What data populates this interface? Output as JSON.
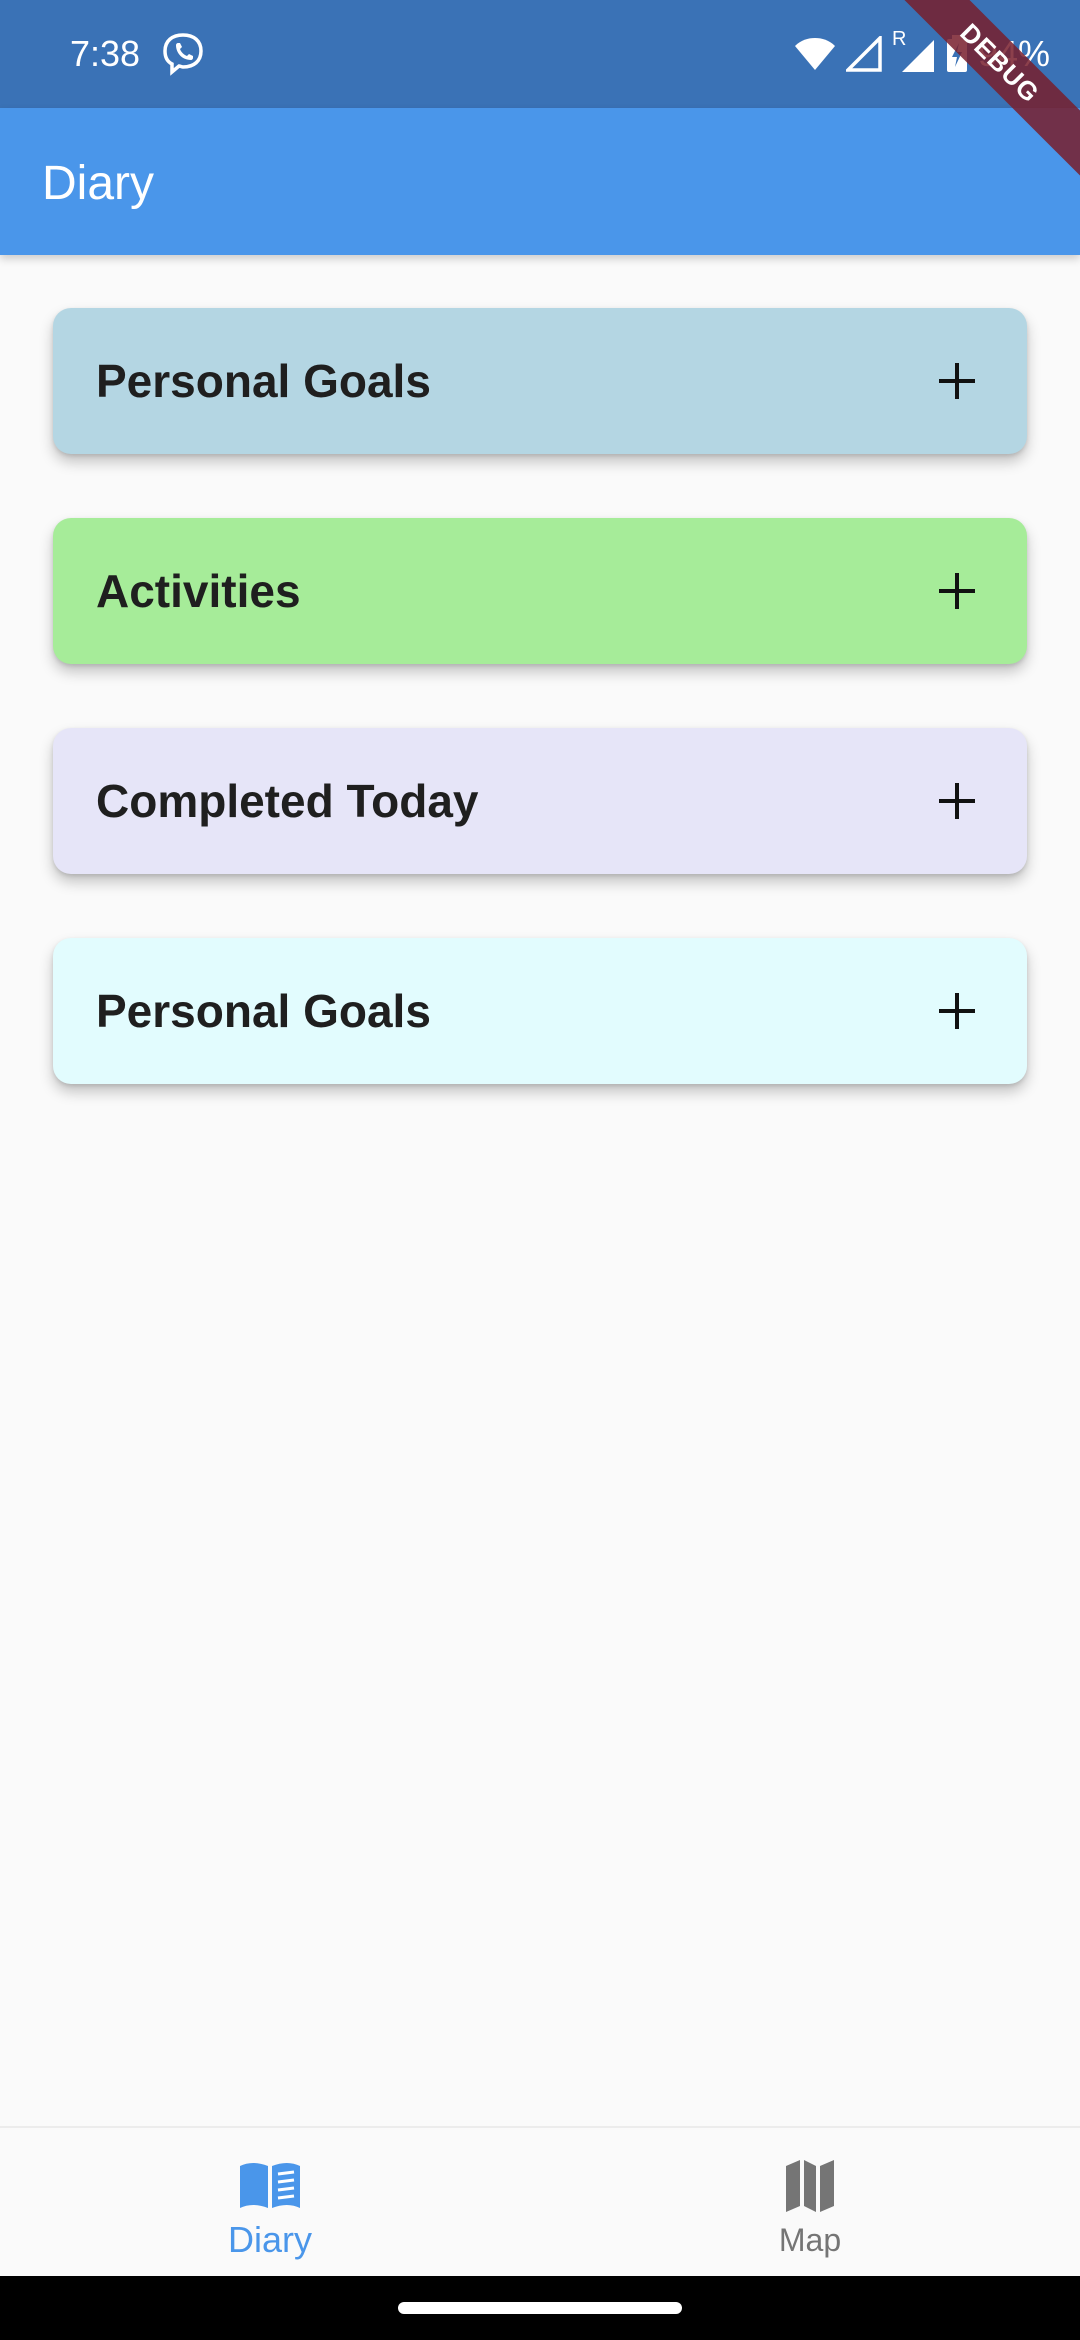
{
  "status_bar": {
    "time": "7:38",
    "battery": "94%",
    "roaming_indicator": "R",
    "icons": [
      "viber-icon",
      "wifi-icon",
      "signal-icon",
      "signal-roaming-icon",
      "battery-charging-icon"
    ]
  },
  "debug_banner": "DEBUG",
  "app_bar": {
    "title": "Diary"
  },
  "cards": [
    {
      "title": "Personal Goals",
      "color": "#b4d6e3",
      "action_icon": "plus-icon"
    },
    {
      "title": "Activities",
      "color": "#a6ec99",
      "action_icon": "plus-icon"
    },
    {
      "title": "Completed Today",
      "color": "#e6e5f8",
      "action_icon": "plus-icon"
    },
    {
      "title": "Personal Goals",
      "color": "#e2fcfe",
      "action_icon": "plus-icon"
    }
  ],
  "bottom_nav": {
    "items": [
      {
        "label": "Diary",
        "icon": "book-icon",
        "active": true
      },
      {
        "label": "Map",
        "icon": "map-icon",
        "active": false
      }
    ]
  },
  "colors": {
    "status_bar": "#3a72b6",
    "app_bar": "#4a96ea",
    "active_nav": "#4a96ea",
    "inactive_nav": "#757575",
    "background": "#fafafa"
  }
}
